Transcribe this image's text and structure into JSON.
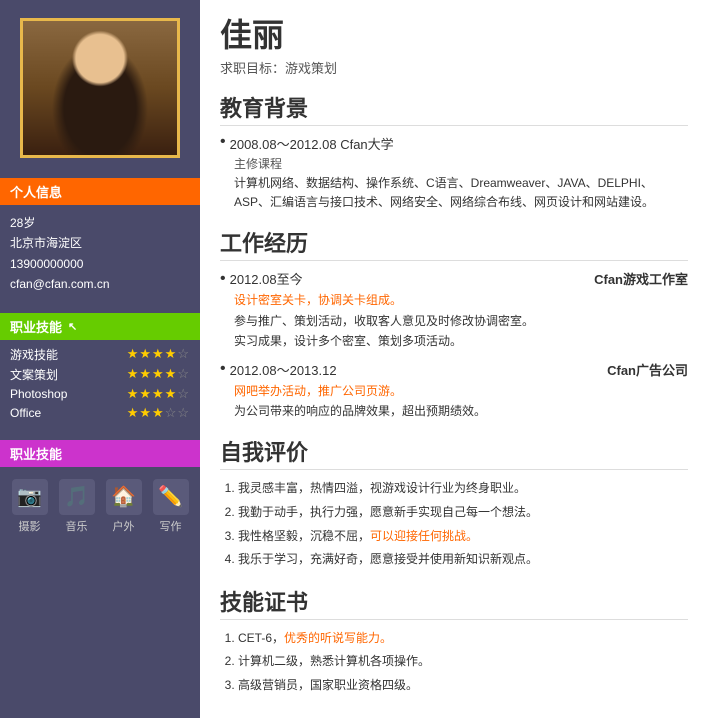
{
  "sidebar": {
    "section_personal": "个人信息",
    "section_skills": "职业技能",
    "section_hobbies": "职业技能",
    "age": "28岁",
    "location": "北京市海淀区",
    "phone": "13900000000",
    "email": "cfan@cfan.com.cn",
    "skills": [
      {
        "name": "游戏技能",
        "full": 4,
        "empty": 1
      },
      {
        "name": "文案策划",
        "full": 4,
        "empty": 1
      },
      {
        "name": "Photoshop",
        "full": 4,
        "empty": 1
      },
      {
        "name": "Office",
        "full": 3,
        "empty": 2
      }
    ],
    "hobbies": [
      {
        "icon": "📷",
        "label": "摄影"
      },
      {
        "icon": "🎵",
        "label": "音乐"
      },
      {
        "icon": "🏠",
        "label": "户外"
      },
      {
        "icon": "✏️",
        "label": "写作"
      }
    ]
  },
  "main": {
    "name": "佳丽",
    "job_target": "求职目标：游戏策划",
    "edu_title": "教育背景",
    "edu_items": [
      {
        "period": "2008.08～2012.08 Cfan大学",
        "sub_label": "主修课程",
        "content": "计算机网络、数据结构、操作系统、C语言、Dreamweaver、JAVA、DELPHI、ASP、汇编语言与接口技术、网络安全、网络综合布线、网页设计和网站建设。"
      }
    ],
    "work_title": "工作经历",
    "work_items": [
      {
        "period": "2012.08至今",
        "company": "Cfan游戏工作室",
        "detail_orange": "设计密室关卡，协调关卡组成。",
        "detail_normal": "参与推广、策划活动，收取客人意见及时修改协调密室。\n实习成果，设计多个密室、策划多项活动。"
      },
      {
        "period": "2012.08～2013.12",
        "company": "Cfan广告公司",
        "detail_orange": "网吧举办活动，推广公司页游。",
        "detail_normal": "为公司带来的响应的品牌效果，超出预期绩效。"
      }
    ],
    "self_title": "自我评价",
    "self_items": [
      "我灵感丰富，热情四溢，视游戏设计行业为终身职业。",
      "我勤于动手，执行力强，愿意新手实现自己每一个想法。",
      "我性格坚毅，沉稳不屈，可以迎接任何挑战。",
      "我乐于学习，充满好奇，愿意接受并使用新知识新观点。"
    ],
    "cert_title": "技能证书",
    "cert_items": [
      "CET-6，优秀的听说写能力。",
      "计算机二级，熟悉计算机各项操作。",
      "高级营销员，国家职业资格四级。"
    ]
  }
}
